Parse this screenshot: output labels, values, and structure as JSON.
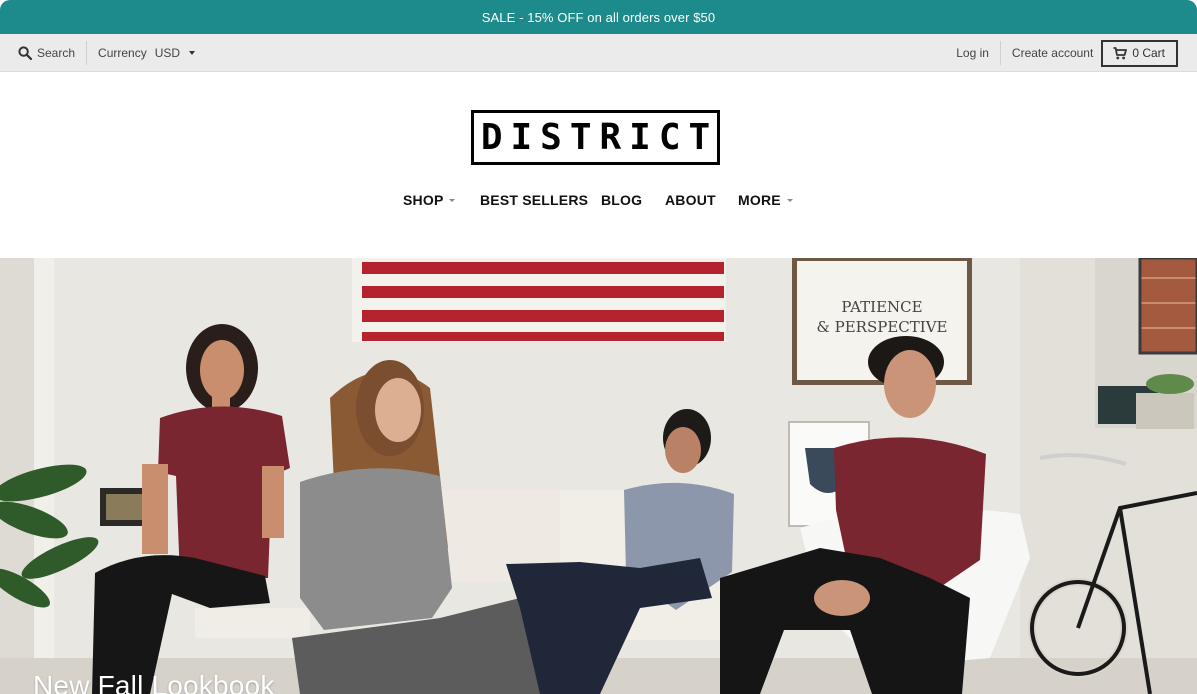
{
  "announcement": {
    "text": "SALE - 15% OFF on all orders over $50"
  },
  "utility_bar": {
    "search_label": "Search",
    "currency_label": "Currency",
    "currency_value": "USD",
    "login_label": "Log in",
    "create_account_label": "Create account",
    "cart_label": "0 Cart"
  },
  "brand": {
    "logo_text": "DISTRICT"
  },
  "nav": {
    "items": [
      {
        "label": "SHOP",
        "has_dropdown": true
      },
      {
        "label": "BEST SELLERS",
        "has_dropdown": false
      },
      {
        "label": "BLOG",
        "has_dropdown": false
      },
      {
        "label": "ABOUT",
        "has_dropdown": false
      },
      {
        "label": "MORE",
        "has_dropdown": true
      }
    ]
  },
  "hero": {
    "title": "New Fall Lookbook",
    "poster_text": "PATIENCE & PERSPECTIVE"
  },
  "colors": {
    "announcement_bg": "#1d8b8b",
    "utility_bg": "#ebebeb",
    "text_dark": "#111111",
    "maroon_tee": "#7a2630",
    "flag_red": "#b5232f"
  },
  "icons": [
    "search-icon",
    "caret-down-icon",
    "cart-icon"
  ]
}
